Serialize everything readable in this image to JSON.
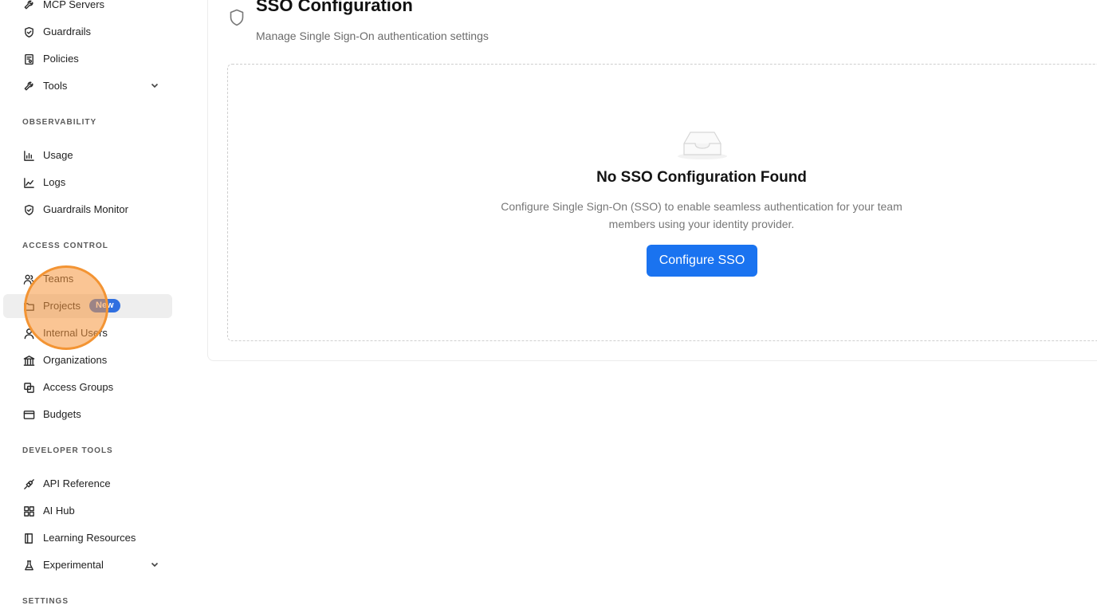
{
  "sidebar": {
    "items": [
      {
        "label": "MCP Servers",
        "icon": "wrench-icon"
      },
      {
        "label": "Guardrails",
        "icon": "shield-check-icon"
      },
      {
        "label": "Policies",
        "icon": "policy-doc-icon"
      },
      {
        "label": "Tools",
        "icon": "wrench-icon",
        "expandable": true
      },
      {
        "label": "Usage",
        "icon": "bar-chart-icon"
      },
      {
        "label": "Logs",
        "icon": "line-chart-icon"
      },
      {
        "label": "Guardrails Monitor",
        "icon": "shield-check-icon"
      },
      {
        "label": "Teams",
        "icon": "team-icon"
      },
      {
        "label": "Projects",
        "icon": "folder-icon",
        "badge": "New",
        "active": true
      },
      {
        "label": "Internal Users",
        "icon": "user-icon"
      },
      {
        "label": "Organizations",
        "icon": "bank-icon"
      },
      {
        "label": "Access Groups",
        "icon": "copy-icon"
      },
      {
        "label": "Budgets",
        "icon": "wallet-icon"
      },
      {
        "label": "API Reference",
        "icon": "api-icon"
      },
      {
        "label": "AI Hub",
        "icon": "grid-icon"
      },
      {
        "label": "Learning Resources",
        "icon": "book-icon"
      },
      {
        "label": "Experimental",
        "icon": "flask-icon",
        "expandable": true
      }
    ],
    "sections": {
      "observability": "OBSERVABILITY",
      "access_control": "ACCESS CONTROL",
      "developer_tools": "DEVELOPER TOOLS",
      "settings": "SETTINGS"
    }
  },
  "main": {
    "title": "SSO Configuration",
    "subtitle": "Manage Single Sign-On authentication settings",
    "empty_state": {
      "title": "No SSO Configuration Found",
      "description": "Configure Single Sign-On (SSO) to enable seamless authentication for your team members using your identity provider.",
      "button_label": "Configure SSO"
    }
  },
  "colors": {
    "primary": "#1a73f0",
    "badge": "#2f6fe0",
    "highlight": "#f39433"
  }
}
